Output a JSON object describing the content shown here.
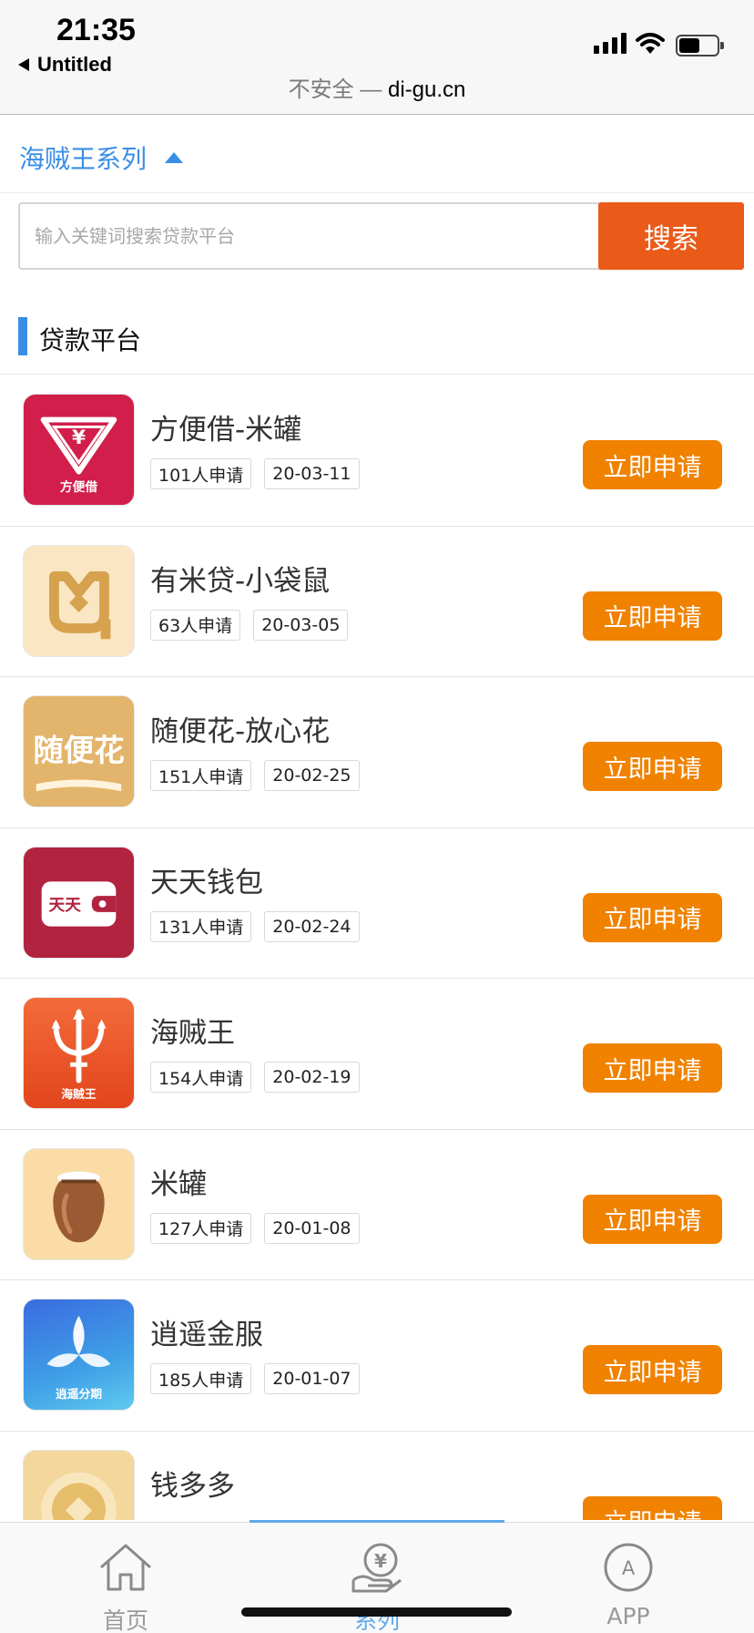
{
  "status_bar": {
    "time": "21:35",
    "back_label": "Untitled",
    "url_insecure": "不安全 —",
    "url_domain": "di-gu.cn",
    "icons": [
      "signal-icon",
      "wifi-icon",
      "battery-icon"
    ]
  },
  "series": {
    "label": "海贼王系列",
    "expanded": true
  },
  "search": {
    "placeholder": "输入关键词搜索贷款平台",
    "value": "",
    "button_label": "搜索"
  },
  "section": {
    "title": "贷款平台"
  },
  "colors": {
    "accent_blue": "#3a8ee6",
    "search_orange": "#ea5a19",
    "apply_orange": "#f08200"
  },
  "loans": [
    {
      "name": "方便借-米罐",
      "applicants": "101人申请",
      "date": "20-03-11",
      "button": "立即申请",
      "logo": "fangbianjie-logo",
      "logo_text": "方便借"
    },
    {
      "name": "有米贷-小袋鼠",
      "applicants": "63人申请",
      "date": "20-03-05",
      "button": "立即申请",
      "logo": "youmidai-logo"
    },
    {
      "name": "随便花-放心花",
      "applicants": "151人申请",
      "date": "20-02-25",
      "button": "立即申请",
      "logo": "suibianhua-logo",
      "logo_text": "随便花"
    },
    {
      "name": "天天钱包",
      "applicants": "131人申请",
      "date": "20-02-24",
      "button": "立即申请",
      "logo": "tiantian-wallet-logo",
      "logo_text": "天天"
    },
    {
      "name": "海贼王",
      "applicants": "154人申请",
      "date": "20-02-19",
      "button": "立即申请",
      "logo": "haizeiwang-trident-logo",
      "logo_text": "海贼王"
    },
    {
      "name": "米罐",
      "applicants": "127人申请",
      "date": "20-01-08",
      "button": "立即申请",
      "logo": "miguan-jar-logo"
    },
    {
      "name": "逍遥金服",
      "applicants": "185人申请",
      "date": "20-01-07",
      "button": "立即申请",
      "logo": "xiaoyao-flower-logo",
      "logo_text": "逍遥分期"
    },
    {
      "name": "钱多多",
      "applicants": "",
      "date": "",
      "button": "立即申请",
      "logo": "qianduoduo-coin-logo"
    }
  ],
  "tabbar": [
    {
      "label": "首页",
      "icon": "home-icon",
      "active": false
    },
    {
      "label": "系列",
      "icon": "yen-hand-icon",
      "active": true
    },
    {
      "label": "APP",
      "icon": "app-store-icon",
      "active": false
    }
  ]
}
